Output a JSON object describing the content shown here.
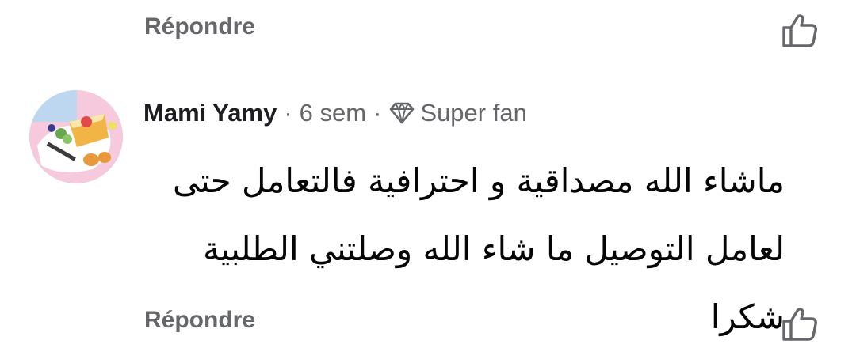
{
  "previous_comment": {
    "reply_label": "Répondre"
  },
  "comment": {
    "author": "Mami Yamy",
    "separator": "·",
    "time": "6 sem",
    "badge_label": "Super fan",
    "badge_icon": "diamond-icon",
    "text": "ماشاء الله مصداقية و احترافية فالتعامل حتى لعامل التوصيل ما شاء الله وصلتني الطلبية شكرا",
    "reply_label": "Répondre",
    "like_icon": "thumbs-up-icon"
  },
  "colors": {
    "secondary_text": "#65676b",
    "primary_text": "#1c1e21",
    "background": "#ffffff"
  }
}
